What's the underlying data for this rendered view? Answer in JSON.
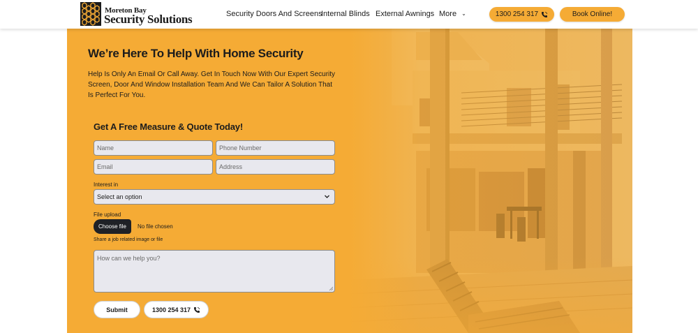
{
  "brand": {
    "line1": "Moreton Bay",
    "line2": "Security Solutions",
    "icon": "honeycomb-logo-icon"
  },
  "nav": {
    "items": [
      {
        "label": "Security Doors And Screens"
      },
      {
        "label": "Internal Blinds"
      },
      {
        "label": "External Awnings"
      },
      {
        "label": "More",
        "icon": "chevron-down-icon"
      }
    ],
    "phone_label": "1300 254 317",
    "phone_icon": "phone-icon",
    "book_label": "Book Online!"
  },
  "hero": {
    "title": "We’re Here To Help With Home Security",
    "intro": "Help Is Only An Email Or Call Away. Get In Touch Now With Our Expert Security Screen, Door And Window Installation Team And We Can Tailor A Solution That Is Perfect For You."
  },
  "form": {
    "title": "Get A Free Measure & Quote Today!",
    "name_placeholder": "Name",
    "phone_placeholder": "Phone Number",
    "email_placeholder": "Email",
    "address_placeholder": "Address",
    "interest_label": "Interest in",
    "interest_value": "Select an option",
    "file_label": "File upload",
    "choose_file_label": "Choose file",
    "no_file_text": "No file chosen",
    "file_help": "Share a job related image or file",
    "message_placeholder": "How can we help you?",
    "submit_label": "Submit",
    "call_label": "1300 254 317"
  },
  "colors": {
    "accent": "#f5ab35",
    "text": "#1c1c1c",
    "input_bg": "#e8e8ee",
    "dark_button": "#1f2126"
  }
}
